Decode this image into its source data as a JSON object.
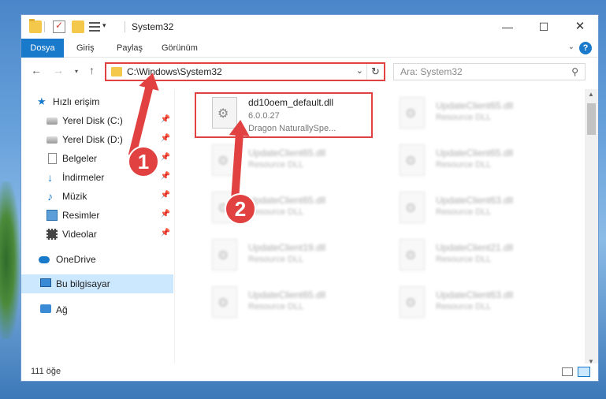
{
  "window": {
    "title": "System32",
    "controls": {
      "minimize": "—",
      "maximize": "☐",
      "close": "✕"
    }
  },
  "ribbon": {
    "tabs": [
      "Dosya",
      "Giriş",
      "Paylaş",
      "Görünüm"
    ],
    "help": "?"
  },
  "address": {
    "path": "C:\\Windows\\System32"
  },
  "search": {
    "placeholder": "Ara: System32"
  },
  "sidebar": {
    "items": [
      {
        "label": "Hızlı erişim",
        "icon": "star-icon",
        "pinned": false
      },
      {
        "label": "Yerel Disk (C:)",
        "icon": "drive-icon",
        "pinned": true
      },
      {
        "label": "Yerel Disk (D:)",
        "icon": "drive-icon",
        "pinned": true
      },
      {
        "label": "Belgeler",
        "icon": "document-icon",
        "pinned": true
      },
      {
        "label": "İndirmeler",
        "icon": "download-icon",
        "pinned": true
      },
      {
        "label": "Müzik",
        "icon": "music-icon",
        "pinned": true
      },
      {
        "label": "Resimler",
        "icon": "pictures-icon",
        "pinned": true
      },
      {
        "label": "Videolar",
        "icon": "video-icon",
        "pinned": true
      },
      {
        "label": "OneDrive",
        "icon": "cloud-icon",
        "pinned": false
      },
      {
        "label": "Bu bilgisayar",
        "icon": "computer-icon",
        "pinned": false
      },
      {
        "label": "Ağ",
        "icon": "network-icon",
        "pinned": false
      }
    ],
    "pin_glyph": "📌"
  },
  "files": [
    {
      "name": "dd10oem_default.dll",
      "version": "6.0.0.27",
      "desc": "Dragon NaturallySpe..."
    },
    {
      "name": "UpdateClient65.dll",
      "desc": "Resource DLL"
    },
    {
      "name": "UpdateClient65.dll",
      "desc": "Resource DLL"
    },
    {
      "name": "UpdateClient65.dll",
      "desc": "Resource DLL"
    },
    {
      "name": "UpdateClient65.dll",
      "desc": "Resource DLL"
    },
    {
      "name": "UpdateClient63.dll",
      "desc": "Resource DLL"
    },
    {
      "name": "UpdateClient19.dll",
      "desc": "Resource DLL"
    },
    {
      "name": "UpdateClient21.dll",
      "desc": "Resource DLL"
    },
    {
      "name": "UpdateClient65.dll",
      "desc": "Resource DLL"
    },
    {
      "name": "UpdateClient63.dll",
      "desc": "Resource DLL"
    }
  ],
  "status": {
    "count": "111 öğe"
  },
  "callouts": {
    "one": "1",
    "two": "2"
  },
  "colors": {
    "accent": "#1979ca",
    "highlight": "#e14141"
  }
}
